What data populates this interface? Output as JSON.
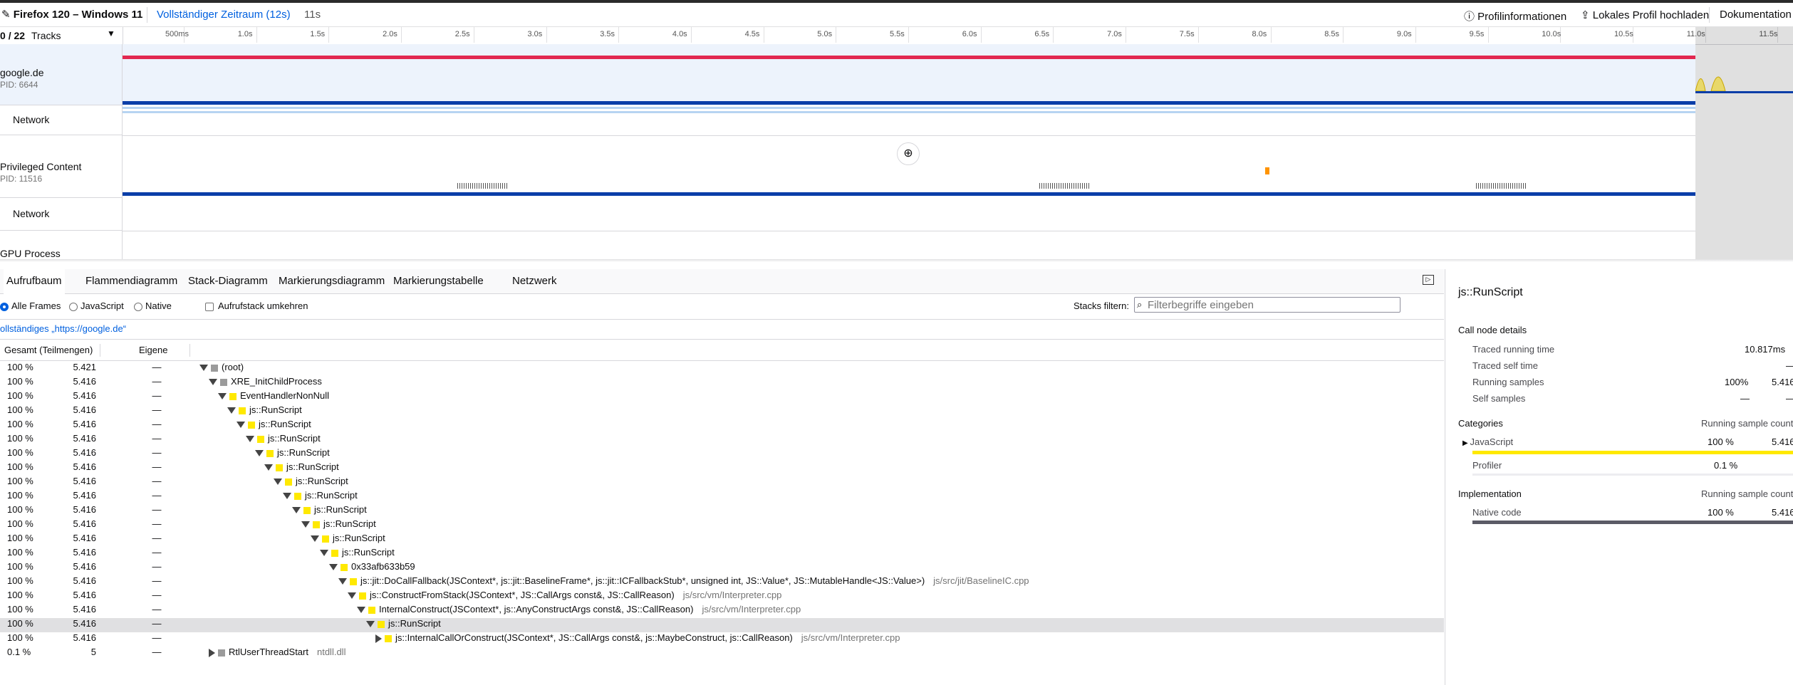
{
  "topbar": {
    "app_title": "Firefox 120 – Windows 11",
    "range_link": "Vollständiger Zeitraum (12s)",
    "range_current": "11s",
    "profile_info": "Profilinformationen",
    "upload": "Lokales Profil hochladen",
    "docs": "Dokumentation"
  },
  "timeline": {
    "track_count_visible": "0",
    "track_count_total": "/ 22",
    "track_label": "Tracks",
    "ticks": [
      "500ms",
      "1.0s",
      "1.5s",
      "2.0s",
      "2.5s",
      "3.0s",
      "3.5s",
      "4.0s",
      "4.5s",
      "5.0s",
      "5.5s",
      "6.0s",
      "6.5s",
      "7.0s",
      "7.5s",
      "8.0s",
      "8.5s",
      "9.0s",
      "9.5s",
      "10.0s",
      "10.5s",
      "11.0s",
      "11.5s"
    ],
    "tracks": [
      {
        "name": "google.de",
        "pid": "PID: 6644"
      },
      {
        "name": "Privileged Content",
        "pid": "PID: 11516"
      },
      {
        "name": "GPU Process",
        "pid": ""
      }
    ],
    "network_label": "Network"
  },
  "tabs": [
    "Aufrufbaum",
    "Flammendiagramm",
    "Stack-Diagramm",
    "Markierungsdiagramm",
    "Markierungstabelle",
    "Netzwerk"
  ],
  "settings": {
    "all_frames": "Alle Frames",
    "javascript": "JavaScript",
    "native": "Native",
    "invert": "Aufrufstack umkehren",
    "filter_label": "Stacks filtern:",
    "filter_placeholder": "Filterbegriffe eingeben"
  },
  "breadcrumb": "ollständiges „https://google.de“",
  "tree": {
    "headers": {
      "total": "Gesamt (Teilmengen)",
      "self": "Eigene"
    },
    "rows": [
      {
        "pct": "100 %",
        "total": "5.421",
        "self": "—",
        "name": "(root)",
        "lib": "",
        "depth": 0,
        "open": true,
        "cat": "grey"
      },
      {
        "pct": "100 %",
        "total": "5.416",
        "self": "—",
        "name": "XRE_InitChildProcess",
        "lib": "",
        "depth": 1,
        "open": true,
        "cat": "grey"
      },
      {
        "pct": "100 %",
        "total": "5.416",
        "self": "—",
        "name": "EventHandlerNonNull",
        "lib": "",
        "depth": 2,
        "open": true,
        "cat": "yellow"
      },
      {
        "pct": "100 %",
        "total": "5.416",
        "self": "—",
        "name": "js::RunScript",
        "lib": "",
        "depth": 3,
        "open": true,
        "cat": "yellow"
      },
      {
        "pct": "100 %",
        "total": "5.416",
        "self": "—",
        "name": "js::RunScript",
        "lib": "",
        "depth": 4,
        "open": true,
        "cat": "yellow"
      },
      {
        "pct": "100 %",
        "total": "5.416",
        "self": "—",
        "name": "js::RunScript",
        "lib": "",
        "depth": 5,
        "open": true,
        "cat": "yellow"
      },
      {
        "pct": "100 %",
        "total": "5.416",
        "self": "—",
        "name": "js::RunScript",
        "lib": "",
        "depth": 6,
        "open": true,
        "cat": "yellow"
      },
      {
        "pct": "100 %",
        "total": "5.416",
        "self": "—",
        "name": "js::RunScript",
        "lib": "",
        "depth": 7,
        "open": true,
        "cat": "yellow"
      },
      {
        "pct": "100 %",
        "total": "5.416",
        "self": "—",
        "name": "js::RunScript",
        "lib": "",
        "depth": 8,
        "open": true,
        "cat": "yellow"
      },
      {
        "pct": "100 %",
        "total": "5.416",
        "self": "—",
        "name": "js::RunScript",
        "lib": "",
        "depth": 9,
        "open": true,
        "cat": "yellow"
      },
      {
        "pct": "100 %",
        "total": "5.416",
        "self": "—",
        "name": "js::RunScript",
        "lib": "",
        "depth": 10,
        "open": true,
        "cat": "yellow"
      },
      {
        "pct": "100 %",
        "total": "5.416",
        "self": "—",
        "name": "js::RunScript",
        "lib": "",
        "depth": 11,
        "open": true,
        "cat": "yellow"
      },
      {
        "pct": "100 %",
        "total": "5.416",
        "self": "—",
        "name": "js::RunScript",
        "lib": "",
        "depth": 12,
        "open": true,
        "cat": "yellow"
      },
      {
        "pct": "100 %",
        "total": "5.416",
        "self": "—",
        "name": "js::RunScript",
        "lib": "",
        "depth": 13,
        "open": true,
        "cat": "yellow"
      },
      {
        "pct": "100 %",
        "total": "5.416",
        "self": "—",
        "name": "0x33afb633b59",
        "lib": "",
        "depth": 14,
        "open": true,
        "cat": "yellow"
      },
      {
        "pct": "100 %",
        "total": "5.416",
        "self": "—",
        "name": "js::jit::DoCallFallback(JSContext*, js::jit::BaselineFrame*, js::jit::ICFallbackStub*, unsigned int, JS::Value*, JS::MutableHandle<JS::Value>)",
        "lib": "js/src/jit/BaselineIC.cpp",
        "depth": 15,
        "open": true,
        "cat": "yellow"
      },
      {
        "pct": "100 %",
        "total": "5.416",
        "self": "—",
        "name": "js::ConstructFromStack(JSContext*, JS::CallArgs const&, JS::CallReason)",
        "lib": "js/src/vm/Interpreter.cpp",
        "depth": 16,
        "open": true,
        "cat": "yellow"
      },
      {
        "pct": "100 %",
        "total": "5.416",
        "self": "—",
        "name": "InternalConstruct(JSContext*, js::AnyConstructArgs const&, JS::CallReason)",
        "lib": "js/src/vm/Interpreter.cpp",
        "depth": 17,
        "open": true,
        "cat": "yellow"
      },
      {
        "pct": "100 %",
        "total": "5.416",
        "self": "—",
        "name": "js::RunScript",
        "lib": "",
        "depth": 18,
        "open": true,
        "cat": "yellow",
        "selected": true
      },
      {
        "pct": "100 %",
        "total": "5.416",
        "self": "—",
        "name": "js::InternalCallOrConstruct(JSContext*, JS::CallArgs const&, js::MaybeConstruct, js::CallReason)",
        "lib": "js/src/vm/Interpreter.cpp",
        "depth": 19,
        "open": false,
        "cat": "yellow"
      },
      {
        "pct": "0.1 %",
        "total": "5",
        "self": "—",
        "name": "RtlUserThreadStart",
        "lib": "ntdll.dll",
        "depth": 1,
        "open": false,
        "cat": "grey"
      }
    ]
  },
  "sidebar": {
    "title": "js::RunScript",
    "call_node_details": "Call node details",
    "traced_running_time_label": "Traced running time",
    "traced_running_time_value": "10.817ms",
    "traced_self_time_label": "Traced self time",
    "traced_self_time_value": "—",
    "running_samples_label": "Running samples",
    "running_samples_pct": "100%",
    "running_samples_value": "5.416",
    "self_samples_label": "Self samples",
    "self_samples_pct": "—",
    "self_samples_value": "—",
    "categories_label": "Categories",
    "running_sample_count": "Running sample count",
    "cat_js": "JavaScript",
    "cat_js_pct": "100 %",
    "cat_js_value": "5.416",
    "cat_js_fraction": 1.0,
    "cat_profiler": "Profiler",
    "cat_profiler_pct": "0.1 %",
    "implementation_label": "Implementation",
    "impl_native": "Native code",
    "impl_native_pct": "100 %",
    "impl_native_value": "5.416",
    "impl_native_fraction": 1.0
  },
  "colors": {
    "accent": "#0060df",
    "js_yellow": "#ffe900",
    "grey": "#9b9b9b",
    "red": "#e22850",
    "blue": "#0a3ea8",
    "lightblue": "#b7d4f2",
    "selected_row": "#e0e0e2"
  }
}
